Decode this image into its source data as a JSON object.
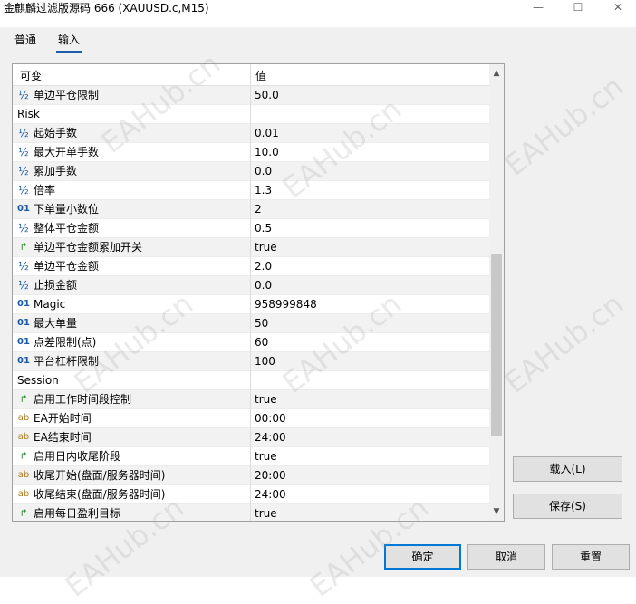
{
  "window": {
    "title": "金麒麟过滤版源码 666 (XAUUSD.c,M15)",
    "minimize_glyph": "—",
    "maximize_glyph": "☐",
    "close_glyph": "✕"
  },
  "tabs": [
    {
      "label": "普通",
      "active": false
    },
    {
      "label": "输入",
      "active": true
    }
  ],
  "grid": {
    "col_name": "可变",
    "col_value": "值",
    "rows": [
      {
        "type": "frac",
        "icon": "½",
        "name": "单边平仓限制",
        "value": "50.0"
      },
      {
        "type": "group",
        "icon": "",
        "name": "Risk",
        "value": ""
      },
      {
        "type": "frac",
        "icon": "½",
        "name": "起始手数",
        "value": "0.01"
      },
      {
        "type": "frac",
        "icon": "½",
        "name": "最大开单手数",
        "value": "10.0"
      },
      {
        "type": "frac",
        "icon": "½",
        "name": "累加手数",
        "value": "0.0"
      },
      {
        "type": "frac",
        "icon": "½",
        "name": "倍率",
        "value": "1.3"
      },
      {
        "type": "num",
        "icon": "01",
        "name": "下单量小数位",
        "value": "2"
      },
      {
        "type": "frac",
        "icon": "½",
        "name": "整体平仓金额",
        "value": "0.5"
      },
      {
        "type": "bool",
        "icon": "↱",
        "name": "单边平仓金额累加开关",
        "value": "true"
      },
      {
        "type": "frac",
        "icon": "½",
        "name": "单边平仓金额",
        "value": "2.0"
      },
      {
        "type": "frac",
        "icon": "½",
        "name": "止损金额",
        "value": "0.0"
      },
      {
        "type": "num",
        "icon": "01",
        "name": "Magic",
        "value": "958999848"
      },
      {
        "type": "num",
        "icon": "01",
        "name": "最大单量",
        "value": "50"
      },
      {
        "type": "num",
        "icon": "01",
        "name": "点差限制(点)",
        "value": "60"
      },
      {
        "type": "num",
        "icon": "01",
        "name": "平台杠杆限制",
        "value": "100"
      },
      {
        "type": "group",
        "icon": "",
        "name": "Session",
        "value": ""
      },
      {
        "type": "bool",
        "icon": "↱",
        "name": "启用工作时间段控制",
        "value": "true"
      },
      {
        "type": "str",
        "icon": "ab",
        "name": "EA开始时间",
        "value": "00:00"
      },
      {
        "type": "str",
        "icon": "ab",
        "name": "EA结束时间",
        "value": "24:00"
      },
      {
        "type": "bool",
        "icon": "↱",
        "name": "启用日内收尾阶段",
        "value": "true"
      },
      {
        "type": "str",
        "icon": "ab",
        "name": "收尾开始(盘面/服务器时间)",
        "value": "20:00"
      },
      {
        "type": "str",
        "icon": "ab",
        "name": "收尾结束(盘面/服务器时间)",
        "value": "24:00"
      },
      {
        "type": "bool",
        "icon": "↱",
        "name": "启用每日盈利目标",
        "value": "true"
      }
    ]
  },
  "scrollbar": {
    "up_glyph": "▲",
    "down_glyph": "▼"
  },
  "side_buttons": {
    "load": "载入(L)",
    "save": "保存(S)"
  },
  "footer_buttons": {
    "ok": "确定",
    "cancel": "取消",
    "reset": "重置"
  },
  "watermark_text": "EAHub.cn"
}
